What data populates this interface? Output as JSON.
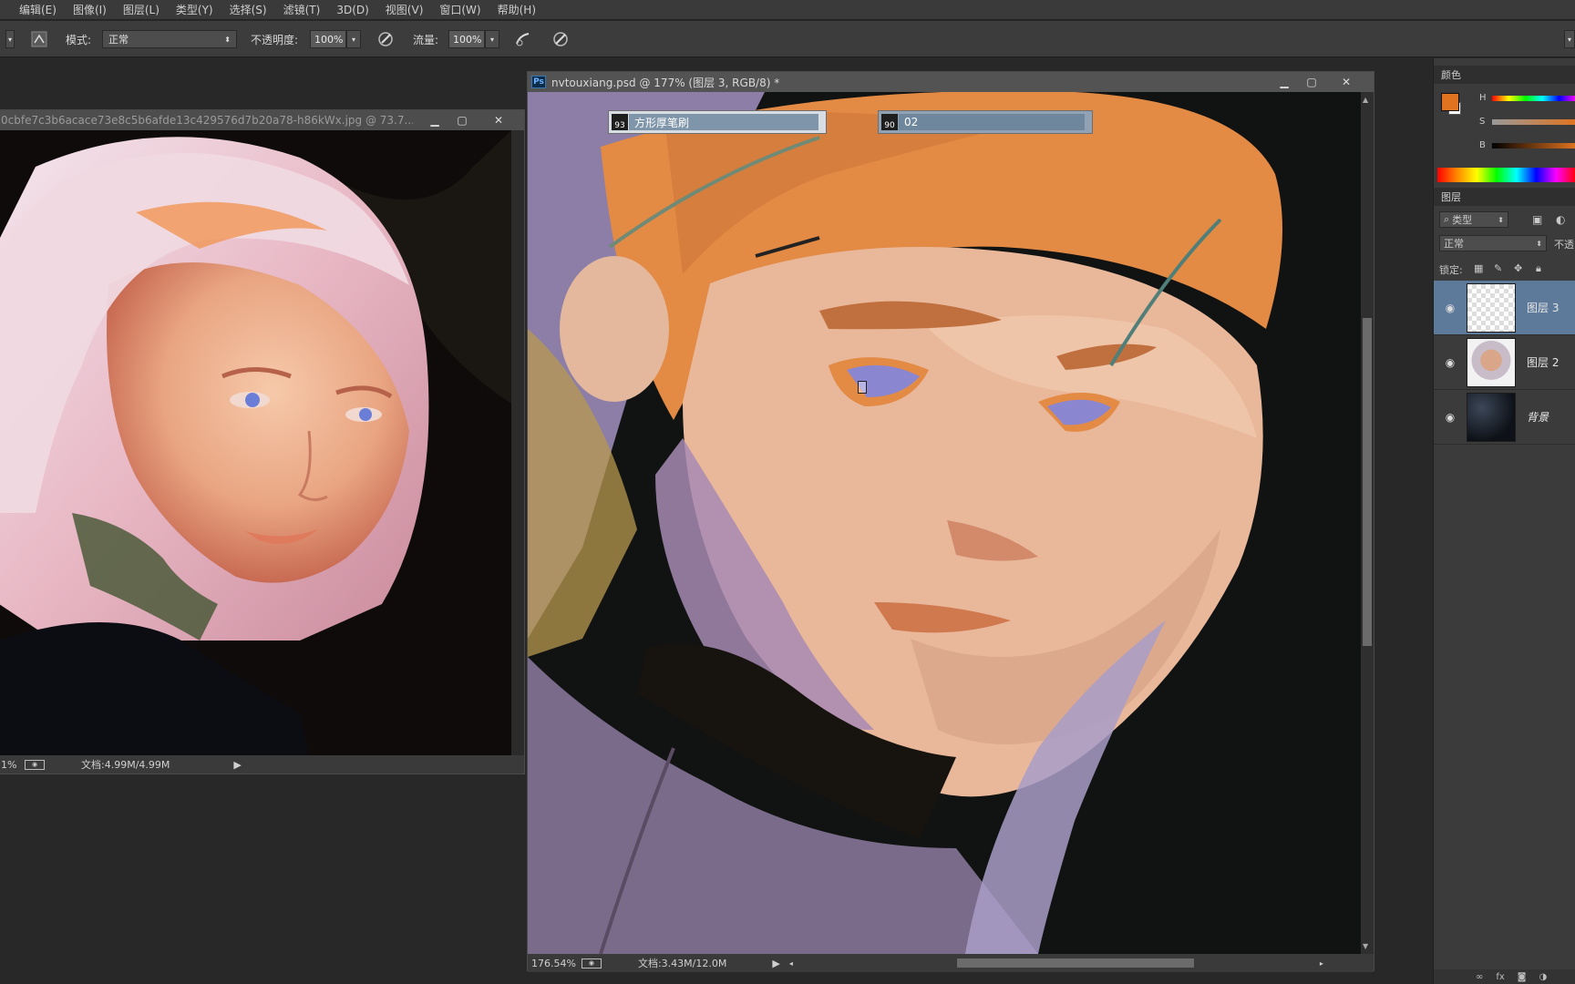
{
  "menu": [
    "编辑(E)",
    "图像(I)",
    "图层(L)",
    "类型(Y)",
    "选择(S)",
    "滤镜(T)",
    "3D(D)",
    "视图(V)",
    "窗口(W)",
    "帮助(H)"
  ],
  "options": {
    "mode_label": "模式:",
    "mode_value": "正常",
    "opacity_label": "不透明度:",
    "opacity_value": "100%",
    "flow_label": "流量:",
    "flow_value": "100%"
  },
  "ref_window": {
    "title": "0cbfe7c3b6acace73e8c5b6afde13c429576d7b20a78-h86kWx.jpg @ 73.7...",
    "zoom": "1%",
    "doc_info": "文档:4.99M/4.99M"
  },
  "main_window": {
    "app_badge": "Ps",
    "title": "nvtouxiang.psd @ 177% (图层 3, RGB/8) *",
    "zoom": "176.54%",
    "doc_info": "文档:3.43M/12.0M",
    "brush_preset": {
      "size": "93",
      "name": "方形厚笔刷"
    },
    "brush_preset2": {
      "size": "90",
      "name": "02"
    }
  },
  "color_panel": {
    "tab": "颜色",
    "h_label": "H",
    "s_label": "S",
    "b_label": "B",
    "foreground": "#e0731f",
    "background": "#ffffff"
  },
  "layers_panel": {
    "tab": "图层",
    "kind_filter": "类型",
    "blend_mode": "正常",
    "opacity_label": "不透",
    "lock_label": "锁定:",
    "layers": [
      {
        "name": "图层 3",
        "selected": true,
        "visible": true
      },
      {
        "name": "图层 2",
        "selected": false,
        "visible": true
      },
      {
        "name": "背景",
        "selected": false,
        "visible": true
      }
    ]
  },
  "colors": {
    "accent_selected": "#5d7a9b",
    "chrome_dark": "#282828"
  }
}
